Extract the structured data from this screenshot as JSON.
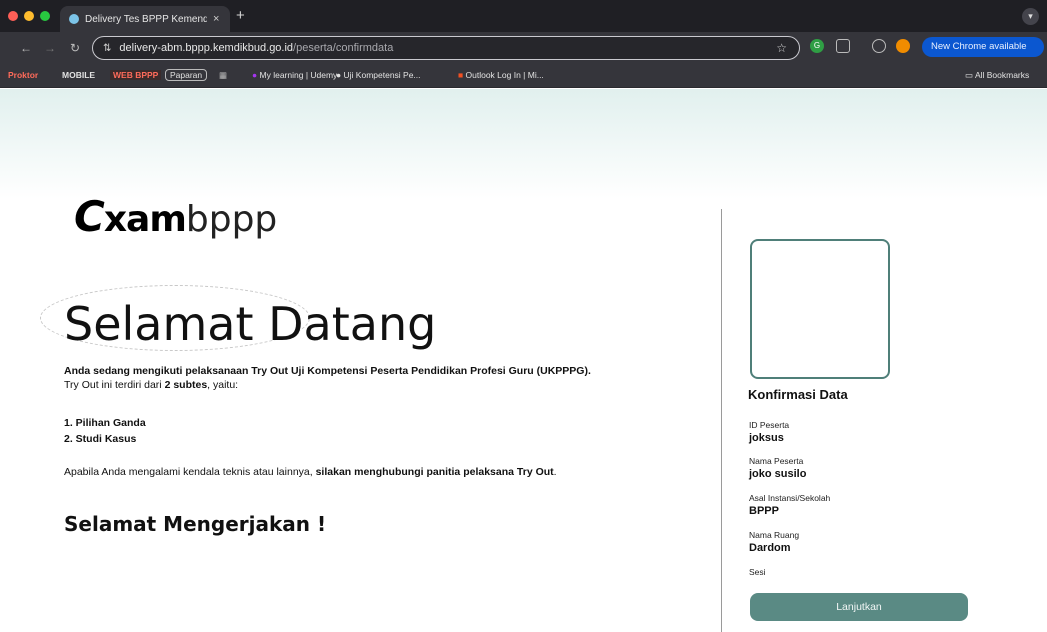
{
  "browser": {
    "tab_title": "Delivery Tes BPPP Kemendikbud",
    "tab_close": "×",
    "new_tab": "+",
    "url_host": "delivery-abm.bppp.kemdikbud.go.id",
    "url_path": "/peserta/confirmdata",
    "update_label": "New Chrome available",
    "bookmarks": [
      {
        "label": "Proktor"
      },
      {
        "label": "MOBILE"
      },
      {
        "label": "WEB BPPP"
      },
      {
        "label": "Paparan"
      },
      {
        "label": "My learning | Udemy"
      },
      {
        "label": "Uji Kompetensi Pe..."
      },
      {
        "label": "Outlook Log In | Mi..."
      },
      {
        "label": "All Bookmarks"
      }
    ],
    "colors": {
      "frame": "#1f1f24",
      "toolbar": "#35353b",
      "update_button": "#0b57d0"
    }
  },
  "logo": {
    "mark": "C",
    "bold": "xam",
    "light": "bppp"
  },
  "main": {
    "heading": "Selamat Datang",
    "intro_bold": "Anda sedang mengikuti pelaksanaan Try Out Uji Kompetensi Peserta Pendidikan Profesi Guru (UKPPPG).",
    "intro_line_a": "Try Out ini terdiri dari ",
    "intro_line_bold": "2 subtes",
    "intro_line_b": ", yaitu:",
    "subtests": [
      "1. Pilihan Ganda",
      "2. Studi Kasus"
    ],
    "contact_a": "Apabila Anda mengalami kendala teknis atau lainnya, ",
    "contact_bold": "silakan menghubungi panitia pelaksana Try Out",
    "contact_end": ".",
    "closing": "Selamat Mengerjakan !"
  },
  "confirm": {
    "title": "Konfirmasi Data",
    "fields": [
      {
        "label": "ID Peserta",
        "value": "joksus"
      },
      {
        "label": "Nama Peserta",
        "value": "joko susilo"
      },
      {
        "label": "Asal Instansi/Sekolah",
        "value": "BPPP"
      },
      {
        "label": "Nama Ruang",
        "value": "Dardom"
      },
      {
        "label": "Sesi",
        "value": ""
      }
    ],
    "button": "Lanjutkan",
    "accent": "#5a8a84"
  }
}
